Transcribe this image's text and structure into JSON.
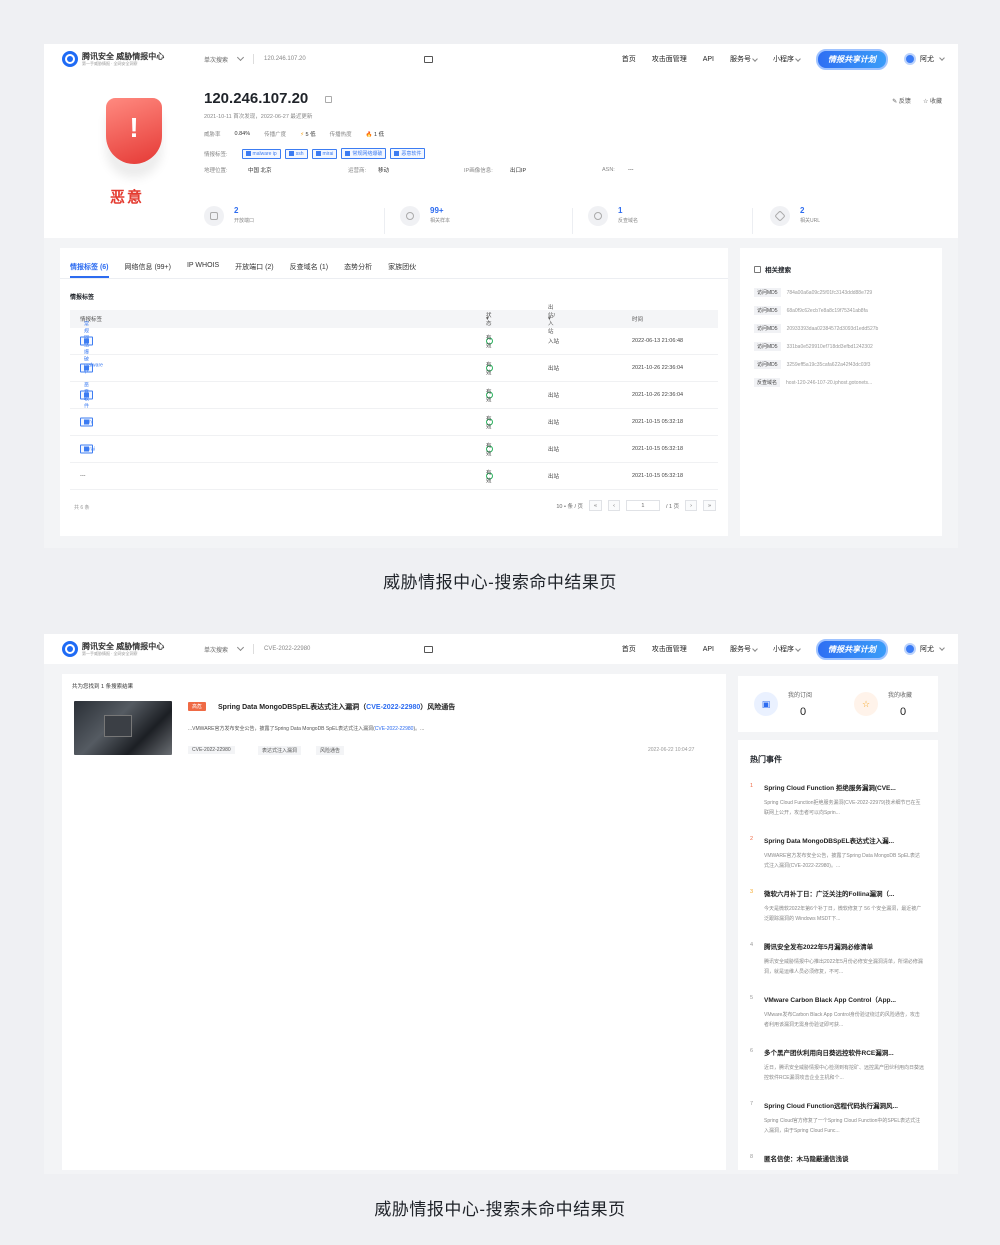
{
  "header": {
    "logo_main": "腾讯安全  威胁情报中心",
    "logo_sub": "第一手威胁情报 · 全网安全洞察",
    "search_type": "单次搜索",
    "nav": [
      "首页",
      "攻击面管理",
      "API",
      "服务号",
      "小程序"
    ],
    "share_label": "情报共享计划",
    "user": "阿尤"
  },
  "shot1": {
    "ip": "120.246.107.20",
    "search_value": "120.246.107.20",
    "dates": "2021-10-11 首次发现，2022-06-27 最近更新",
    "verdict": "恶意",
    "threat_rate_label": "威胁率",
    "threat_rate": "0.84%",
    "spread_label": "传播广度",
    "spread_value": "5  低",
    "heat_label": "传播热度",
    "heat_value": "1  低",
    "tags_label": "情报标签:",
    "tags": [
      "malware ip",
      "ssh",
      "mirai",
      "常规网络爆破",
      "恶意软件"
    ],
    "geo_label": "地理位置:",
    "geo": "中国 北京",
    "isp_label": "运营商:",
    "isp": "移动",
    "ipinfo_label": "IP画像信息:",
    "ipinfo": "出口IP",
    "asn_label": "ASN:",
    "asn": "---",
    "actions": [
      "反馈",
      "收藏"
    ],
    "stats": [
      {
        "value": "2",
        "label": "开放端口"
      },
      {
        "value": "99+",
        "label": "相关样本"
      },
      {
        "value": "1",
        "label": "反查域名"
      },
      {
        "value": "2",
        "label": "相关URL"
      }
    ],
    "tabs": [
      "情报标签 (6)",
      "网络信息 (99+)",
      "IP WHOIS",
      "开放端口 (2)",
      "反查域名 (1)",
      "态势分析",
      "家族团伙"
    ],
    "section_title": "情报标签",
    "table_headers": [
      "情报标签",
      "状态",
      "出站/入站",
      "时间"
    ],
    "rows": [
      {
        "tag": "常规网络爆破",
        "status": "有效",
        "dir": "入站",
        "time": "2022-06-13 21:06:48"
      },
      {
        "tag": "malware ip",
        "status": "有效",
        "dir": "出站",
        "time": "2021-10-26 22:36:04"
      },
      {
        "tag": "恶意软件",
        "status": "有效",
        "dir": "出站",
        "time": "2021-10-26 22:36:04"
      },
      {
        "tag": "ssh",
        "status": "有效",
        "dir": "出站",
        "time": "2021-10-15 05:32:18"
      },
      {
        "tag": "mirai",
        "status": "有效",
        "dir": "出站",
        "time": "2021-10-15 05:32:18"
      },
      {
        "tag": "---",
        "status": "有效",
        "dir": "出站",
        "time": "2021-10-15 05:32:18"
      }
    ],
    "total": "共 6 条",
    "page_size": "10 • 条 / 页",
    "page_current": "1",
    "page_total": "/ 1 页",
    "side_title": "相关搜索",
    "side_items": [
      {
        "k": "访问MD5",
        "v": "784a00a6a09c25f01fc3143ddd88e729"
      },
      {
        "k": "访问MD5",
        "v": "68a0f9c62ecb7e8a8c19f75341ab8fa"
      },
      {
        "k": "访问MD5",
        "v": "20933393daa02384572d3093d1edd527b"
      },
      {
        "k": "访问MD5",
        "v": "331ba0e529910ef718dd3efbd1242302"
      },
      {
        "k": "访问MD5",
        "v": "3259eff5a19c35cafa622a42f43dc03f3"
      },
      {
        "k": "反查域名",
        "v": "host-120-246-107-20.iphost.gotonets..."
      }
    ]
  },
  "caption1": "威胁情报中心-搜索命中结果页",
  "shot2": {
    "search_value": "CVE-2022-22980",
    "result_count": "共为您找到 1 条搜索结果",
    "risk": "高危",
    "title_pre": "Spring Data MongoDBSpEL表达式注入漏洞（",
    "title_cve": "CVE-2022-22980",
    "title_post": "）风险通告",
    "desc_pre": "...VMWARE官方发布安全公告，披露了Spring Data MongoDB SpEL表达式注入漏洞(",
    "desc_cve": "CVE-2022-22980",
    "desc_post": ")。...",
    "tags": [
      "CVE-2022-22980",
      "表达式注入漏洞",
      "风险通告"
    ],
    "date": "2022-06-22 10:04:27",
    "fav": [
      {
        "label": "我的订阅",
        "num": "0"
      },
      {
        "label": "我的收藏",
        "num": "0"
      }
    ],
    "hot_title": "热门事件",
    "hot": [
      {
        "n": "1",
        "h": "Spring Cloud Function 拒绝服务漏洞(CVE...",
        "d": "Spring Cloud Function拒绝服务漏洞(CVE-2022-22979)技术细节已在互联网上公开，攻击者可以向Sprin..."
      },
      {
        "n": "2",
        "h": "Spring Data MongoDBSpEL表达式注入漏...",
        "d": "VMWARE官方发布安全公告，披露了Spring Data MongoDB SpEL表达式注入漏洞(CVE-2022-22980)。..."
      },
      {
        "n": "3",
        "h": "微软六月补丁日：广泛关注的Follina漏洞（...",
        "d": "今天是微软2022年第6个补丁日，微软修复了 56 个安全漏洞，最近被广泛跟踪漏洞的 Windows MSDT下..."
      },
      {
        "n": "4",
        "h": "腾讯安全发布2022年5月漏洞必修清单",
        "d": "腾讯安全威胁情报中心推出2022年5月份必修安全漏洞清单，所谓必修漏洞，就是运维人员必须修复，不可..."
      },
      {
        "n": "5",
        "h": "VMware Carbon Black App Control（App...",
        "d": "VMware发布Carbon Black App Control身份验证绕过的风险通告，攻击者利用该漏洞无需身份验证即可获..."
      },
      {
        "n": "6",
        "h": "多个黑产团伙利用向日葵远控软件RCE漏洞...",
        "d": "近日，腾讯安全威胁情报中心检测到有挖矿、远控黑产团伙利用向日葵远控软件RCE漏洞攻击企业主机和个..."
      },
      {
        "n": "7",
        "h": "Spring Cloud Function远程代码执行漏洞风...",
        "d": "Spring Cloud官方修复了一个Spring Cloud Function中的SPEL表达式注入漏洞，由于Spring Cloud Func..."
      },
      {
        "n": "8",
        "h": "匿名信使：木马隐蔽通信浅谈",
        "d": ""
      }
    ]
  },
  "caption2": "威胁情报中心-搜索未命中结果页"
}
